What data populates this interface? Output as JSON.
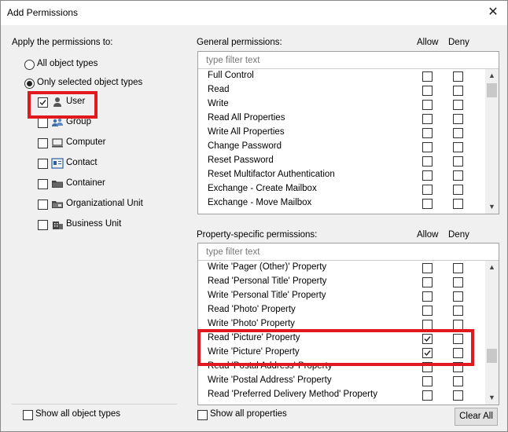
{
  "window": {
    "title": "Add Permissions",
    "close_glyph": "✕"
  },
  "left": {
    "apply_label": "Apply the permissions to:",
    "radio_all": "All object types",
    "radio_selected": "Only selected object types",
    "selected_radio": "selected",
    "object_types": [
      {
        "label": "User",
        "checked": true,
        "icon": "user-icon"
      },
      {
        "label": "Group",
        "checked": false,
        "icon": "group-icon"
      },
      {
        "label": "Computer",
        "checked": false,
        "icon": "computer-icon"
      },
      {
        "label": "Contact",
        "checked": false,
        "icon": "contact-icon"
      },
      {
        "label": "Container",
        "checked": false,
        "icon": "folder-icon"
      },
      {
        "label": "Organizational Unit",
        "checked": false,
        "icon": "ou-icon"
      },
      {
        "label": "Business Unit",
        "checked": false,
        "icon": "business-unit-icon"
      }
    ],
    "show_all_label": "Show all object types"
  },
  "general": {
    "label": "General permissions:",
    "allow_header": "Allow",
    "deny_header": "Deny",
    "filter_placeholder": "type filter text",
    "rows": [
      {
        "name": "Full Control",
        "allow": false,
        "deny": false
      },
      {
        "name": "Read",
        "allow": false,
        "deny": false
      },
      {
        "name": "Write",
        "allow": false,
        "deny": false
      },
      {
        "name": "Read All Properties",
        "allow": false,
        "deny": false
      },
      {
        "name": "Write All Properties",
        "allow": false,
        "deny": false
      },
      {
        "name": "Change Password",
        "allow": false,
        "deny": false
      },
      {
        "name": "Reset Password",
        "allow": false,
        "deny": false
      },
      {
        "name": "Reset Multifactor Authentication",
        "allow": false,
        "deny": false
      },
      {
        "name": "Exchange - Create Mailbox",
        "allow": false,
        "deny": false
      },
      {
        "name": "Exchange - Move Mailbox",
        "allow": false,
        "deny": false
      }
    ]
  },
  "property": {
    "label": "Property-specific permissions:",
    "allow_header": "Allow",
    "deny_header": "Deny",
    "filter_placeholder": "type filter text",
    "rows": [
      {
        "name": "Write 'Pager (Other)' Property",
        "allow": false,
        "deny": false
      },
      {
        "name": "Read 'Personal Title' Property",
        "allow": false,
        "deny": false
      },
      {
        "name": "Write 'Personal Title' Property",
        "allow": false,
        "deny": false
      },
      {
        "name": "Read 'Photo' Property",
        "allow": false,
        "deny": false
      },
      {
        "name": "Write 'Photo' Property",
        "allow": false,
        "deny": false
      },
      {
        "name": "Read 'Picture' Property",
        "allow": true,
        "deny": false
      },
      {
        "name": "Write 'Picture' Property",
        "allow": true,
        "deny": false
      },
      {
        "name": "Read 'Postal Address' Property",
        "allow": false,
        "deny": false
      },
      {
        "name": "Write 'Postal Address' Property",
        "allow": false,
        "deny": false
      },
      {
        "name": "Read 'Preferred Delivery Method' Property",
        "allow": false,
        "deny": false
      }
    ],
    "show_all_label": "Show all properties",
    "clear_all_label": "Clear All"
  },
  "colors": {
    "highlight": "#e1191f",
    "dialog_bg": "#f0f0f0"
  }
}
